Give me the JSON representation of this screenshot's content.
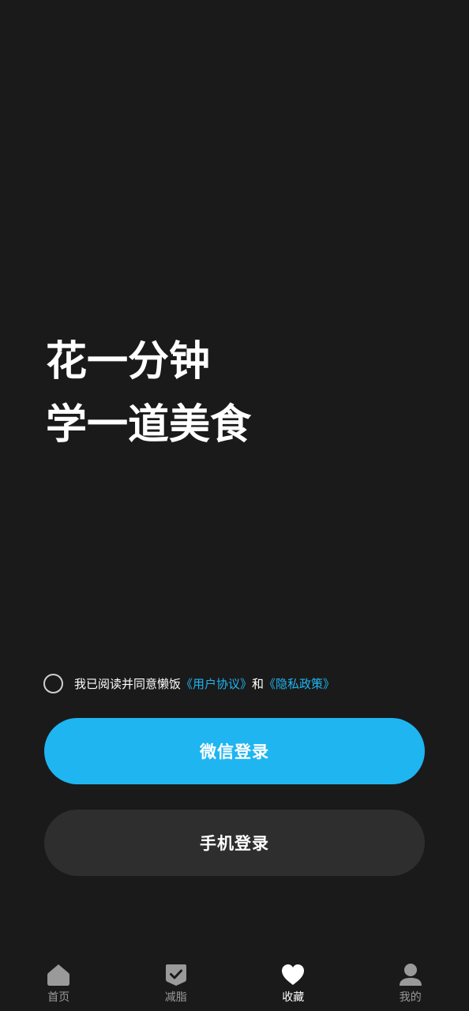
{
  "hero": {
    "line1": "花一分钟",
    "line2": "学一道美食"
  },
  "agreement": {
    "prefix": "我已阅读并同意懒饭",
    "user_agreement": "《用户协议》",
    "conjunction": "和",
    "privacy_policy": "《隐私政策》",
    "checked": false
  },
  "buttons": {
    "wechat_login": "微信登录",
    "phone_login": "手机登录"
  },
  "tabbar": {
    "items": [
      {
        "label": "首页",
        "icon": "home-icon",
        "active": false
      },
      {
        "label": "减脂",
        "icon": "check-shield-icon",
        "active": false
      },
      {
        "label": "收藏",
        "icon": "heart-icon",
        "active": true
      },
      {
        "label": "我的",
        "icon": "user-icon",
        "active": false
      }
    ]
  },
  "colors": {
    "background": "#1a1a1a",
    "accent": "#1fb5f1",
    "link": "#1fb5f0",
    "secondary_button": "#2e2e2e",
    "inactive_tab": "#9a9a9a"
  }
}
